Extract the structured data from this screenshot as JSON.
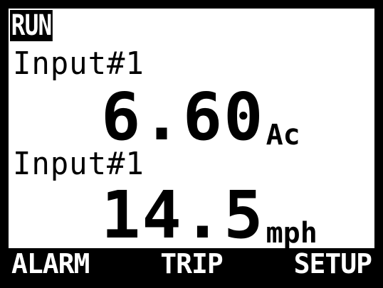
{
  "status": {
    "mode": "RUN"
  },
  "channels": [
    {
      "label": "Input#1",
      "value": "6.60",
      "unit": "Ac"
    },
    {
      "label": "Input#1",
      "value": "14.5",
      "unit": "mph"
    }
  ],
  "softkeys": [
    {
      "label": "ALARM"
    },
    {
      "label": "TRIP"
    },
    {
      "label": "SETUP"
    }
  ],
  "colors": {
    "background": "#ffffff",
    "foreground": "#000000",
    "bezel": "#000000"
  }
}
